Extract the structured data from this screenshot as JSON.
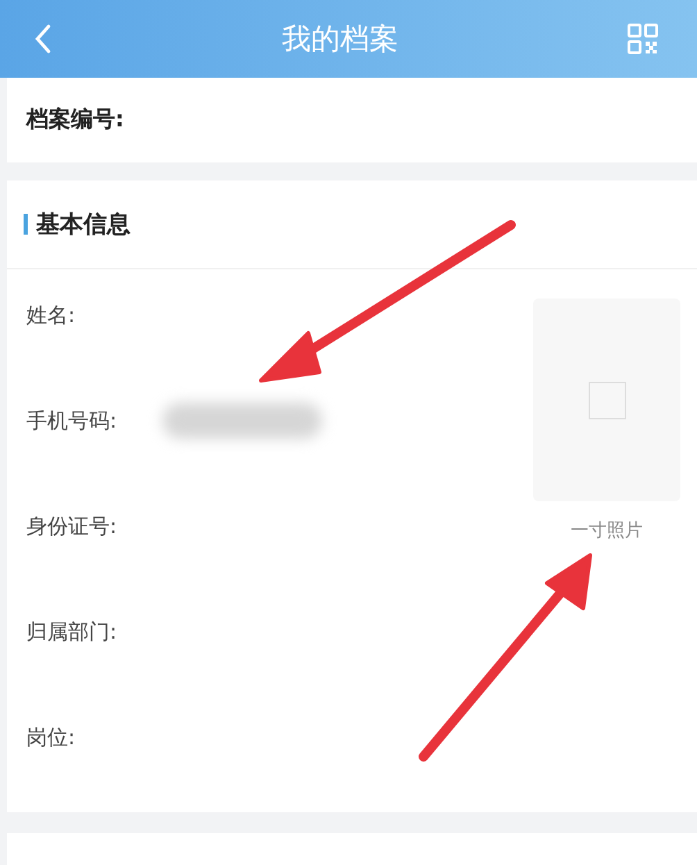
{
  "header": {
    "title": "我的档案"
  },
  "archive": {
    "label": "档案编号:"
  },
  "section": {
    "title": "基本信息"
  },
  "fields": [
    {
      "label": "姓名:",
      "redacted": false
    },
    {
      "label": "手机号码:",
      "redacted": true
    },
    {
      "label": "身份证号:",
      "redacted": false
    },
    {
      "label": "归属部门:",
      "redacted": false
    },
    {
      "label": "岗位:",
      "redacted": false
    }
  ],
  "photo": {
    "caption": "一寸照片"
  }
}
